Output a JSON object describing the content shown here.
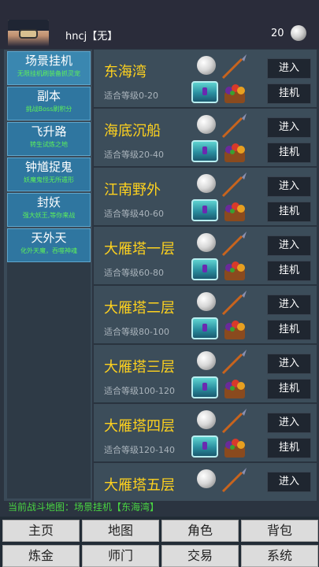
{
  "header": {
    "username": "hncj【无】",
    "coin_count": "20"
  },
  "menu": [
    {
      "name": "场景挂机",
      "sub": "无限挂机刷装备抓灵宠",
      "active": true
    },
    {
      "name": "副本",
      "sub": "挑战Boss刷积分",
      "active": false
    },
    {
      "name": "飞升路",
      "sub": "转生试炼之地",
      "active": false
    },
    {
      "name": "钟馗捉鬼",
      "sub": "妖魔鬼怪无所遁形",
      "active": false
    },
    {
      "name": "封妖",
      "sub": "强大妖王,等你来战",
      "active": false
    },
    {
      "name": "天外天",
      "sub": "化外天魔，吞噬神魂",
      "active": false
    }
  ],
  "maps": [
    {
      "name": "东海湾",
      "level": "适合等级0-20"
    },
    {
      "name": "海底沉船",
      "level": "适合等级20-40"
    },
    {
      "name": "江南野外",
      "level": "适合等级40-60"
    },
    {
      "name": "大雁塔一层",
      "level": "适合等级60-80"
    },
    {
      "name": "大雁塔二层",
      "level": "适合等级80-100"
    },
    {
      "name": "大雁塔三层",
      "level": "适合等级100-120"
    },
    {
      "name": "大雁塔四层",
      "level": "适合等级120-140"
    },
    {
      "name": "大雁塔五层",
      "level": ""
    }
  ],
  "buttons": {
    "enter": "进入",
    "afk": "挂机"
  },
  "status_text": "当前战斗地图：场景挂机【东海湾】",
  "nav": [
    "主页",
    "地图",
    "角色",
    "背包",
    "炼金",
    "师门",
    "交易",
    "系统"
  ],
  "colors": {
    "map_name": "#ffd21e",
    "menu_sub": "#5df05a",
    "status": "#49d442",
    "menu_bg": "#2f76a0"
  }
}
